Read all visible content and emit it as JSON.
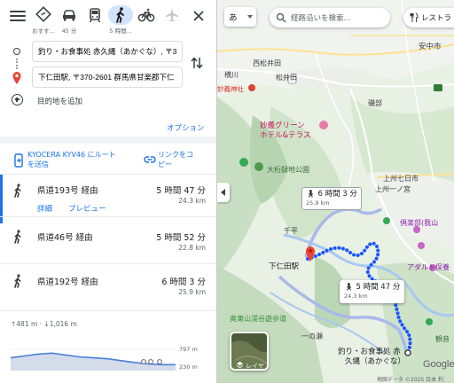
{
  "modes": [
    {
      "name": "best",
      "label": "おすす..."
    },
    {
      "name": "car",
      "label": "45 分"
    },
    {
      "name": "transit",
      "label": ""
    },
    {
      "name": "walk",
      "label": "5 時間..."
    },
    {
      "name": "bicycle",
      "label": ""
    },
    {
      "name": "flight",
      "label": ""
    }
  ],
  "origin_input": {
    "value": "釣り・お食事処 赤久縄（あかぐな）, 〒3"
  },
  "destination_input": {
    "value": "下仁田駅, 〒370-2601 群馬県甘楽郡下仁"
  },
  "add_destination": "目的地を追加",
  "options": "オプション",
  "send": {
    "line1": "KYOCERA KYV46 にルート",
    "line2": "を送信"
  },
  "copy_link": {
    "line1": "リンクをコ",
    "line2": "ピー"
  },
  "routes": [
    {
      "via": "県道193号 経由",
      "time": "5 時間 47 分",
      "distance": "24.3 km",
      "details": "詳細",
      "preview": "プレビュー",
      "selected": true
    },
    {
      "via": "県道46号 経由",
      "time": "5 時間 52 分",
      "distance": "22.8 km"
    },
    {
      "via": "県道192号 経由",
      "time": "6 時間 3 分",
      "distance": "25.9 km"
    }
  ],
  "elevation": {
    "summary": "↑481 m · ↓1,016 m",
    "max": "797 m",
    "min": "230 m"
  },
  "elevation_profile": [
    0.55,
    0.45,
    0.35,
    0.3,
    0.4,
    0.5,
    0.55,
    0.6,
    0.7,
    0.8,
    0.88,
    0.92,
    0.92
  ],
  "map": {
    "lang": "あ",
    "search_placeholder": "経路沿いを検索...",
    "restaurants": "レストラ",
    "labels": {
      "city_right": "安中市",
      "nishimatsuida": "西松井田",
      "matsuida": "松井田",
      "yokogawa": "横川",
      "shrine": "妙義神社",
      "myogi_green1": "妙義グリーン",
      "myogi_green2": "ホテル&テラス",
      "usui": "磯部",
      "omomitsu": "大桁録地公園",
      "kaminisaka": "上州七日市",
      "kamino": "上州一ノ宮",
      "chihira": "千平",
      "shimonita": "下仁田駅",
      "kuraho": "倶楽部(我山",
      "adventure": "アダルト保養",
      "okunishi": "奥東山渓谷遊歩道",
      "ichinose": "一の瀬",
      "destination_line1": "釣り・お食事処 赤",
      "destination_line2": "久縄（あかぐな）",
      "kannonji": "観音"
    },
    "callout_alt": {
      "time": "6 時間 3 分",
      "distance": "25.9 km"
    },
    "callout_selected": {
      "time": "5 時間 47 分",
      "distance": "24.3 km"
    },
    "layers": "レイヤ",
    "google": "Google",
    "attribution": "地図データ ©2025  日本  利"
  },
  "colors": {
    "route": "#1a56ff",
    "route_alt": "#a9b9e8",
    "accent": "#1a73e8"
  }
}
